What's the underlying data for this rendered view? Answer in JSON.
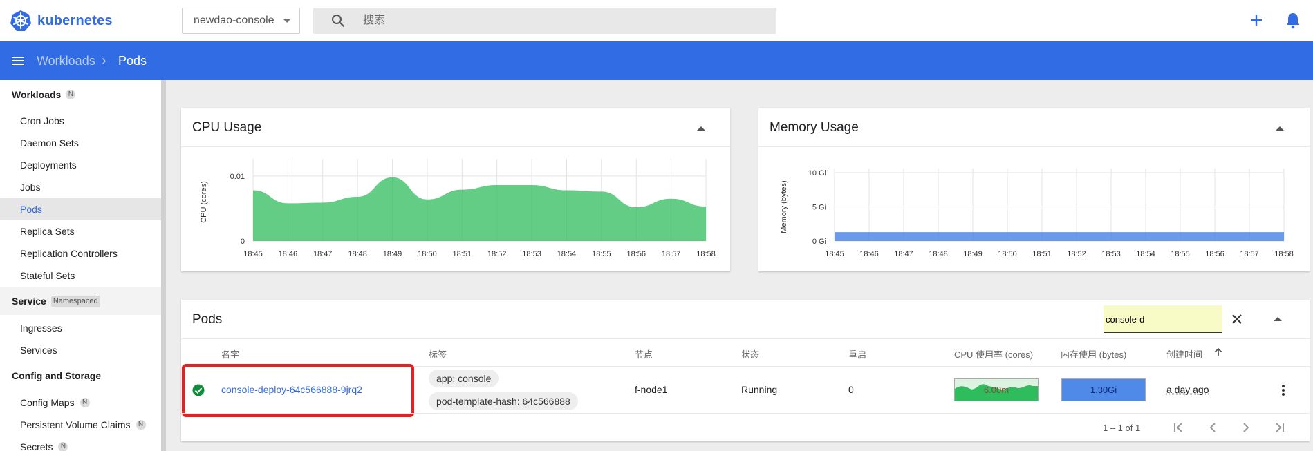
{
  "app": {
    "name": "kubernetes",
    "brand_color": "#326ce5"
  },
  "topbar": {
    "namespace": "newdao-console",
    "search_placeholder": "搜索"
  },
  "breadcrumb": {
    "parent": "Workloads",
    "current": "Pods"
  },
  "sidebar": {
    "workloads": {
      "title": "Workloads",
      "badge": "N",
      "items": [
        {
          "label": "Cron Jobs"
        },
        {
          "label": "Daemon Sets"
        },
        {
          "label": "Deployments"
        },
        {
          "label": "Jobs"
        },
        {
          "label": "Pods",
          "active": true
        },
        {
          "label": "Replica Sets"
        },
        {
          "label": "Replication Controllers"
        },
        {
          "label": "Stateful Sets"
        }
      ]
    },
    "service": {
      "title": "Service",
      "badge": "Namespaced",
      "items": [
        {
          "label": "Ingresses"
        },
        {
          "label": "Services"
        }
      ]
    },
    "config": {
      "title": "Config and Storage",
      "items": [
        {
          "label": "Config Maps",
          "badge": "N"
        },
        {
          "label": "Persistent Volume Claims",
          "badge": "N"
        },
        {
          "label": "Secrets",
          "badge": "N"
        }
      ]
    }
  },
  "chart_data": [
    {
      "type": "area",
      "title": "CPU Usage",
      "ylabel": "CPU (cores)",
      "x": [
        "18:45",
        "18:46",
        "18:47",
        "18:48",
        "18:49",
        "18:50",
        "18:51",
        "18:52",
        "18:53",
        "18:54",
        "18:55",
        "18:56",
        "18:57",
        "18:58"
      ],
      "yticks": [
        "0",
        "0.01"
      ],
      "ylim": [
        0,
        0.012
      ],
      "values": [
        0.0078,
        0.0058,
        0.0059,
        0.0068,
        0.0098,
        0.0064,
        0.0079,
        0.0086,
        0.0086,
        0.0078,
        0.0076,
        0.0052,
        0.0065,
        0.0053
      ],
      "color": "#2fbc5c",
      "grid": true
    },
    {
      "type": "area",
      "title": "Memory Usage",
      "ylabel": "Memory (bytes)",
      "x": [
        "18:45",
        "18:46",
        "18:47",
        "18:48",
        "18:49",
        "18:50",
        "18:51",
        "18:52",
        "18:53",
        "18:54",
        "18:55",
        "18:56",
        "18:57",
        "18:58"
      ],
      "yticks": [
        "0 Gi",
        "5 Gi",
        "10 Gi"
      ],
      "ylim": [
        0,
        10
      ],
      "values": [
        1.3,
        1.3,
        1.3,
        1.3,
        1.3,
        1.3,
        1.3,
        1.3,
        1.3,
        1.3,
        1.3,
        1.3,
        1.3,
        1.3
      ],
      "color": "#3a78e6",
      "grid": true
    }
  ],
  "pods": {
    "title": "Pods",
    "filter_value": "console-d",
    "columns": [
      "名字",
      "标签",
      "节点",
      "状态",
      "重启",
      "CPU 使用率 (cores)",
      "内存使用 (bytes)",
      "创建时间"
    ],
    "rows": [
      {
        "name": "console-deploy-64c566888-9jrq2",
        "labels": [
          "app: console",
          "pod-template-hash: 64c566888"
        ],
        "node": "f-node1",
        "status": "Running",
        "restarts": "0",
        "cpu": "6.00m",
        "memory": "1.30Gi",
        "created": "a day ago"
      }
    ],
    "pagination": "1 – 1 of 1"
  }
}
